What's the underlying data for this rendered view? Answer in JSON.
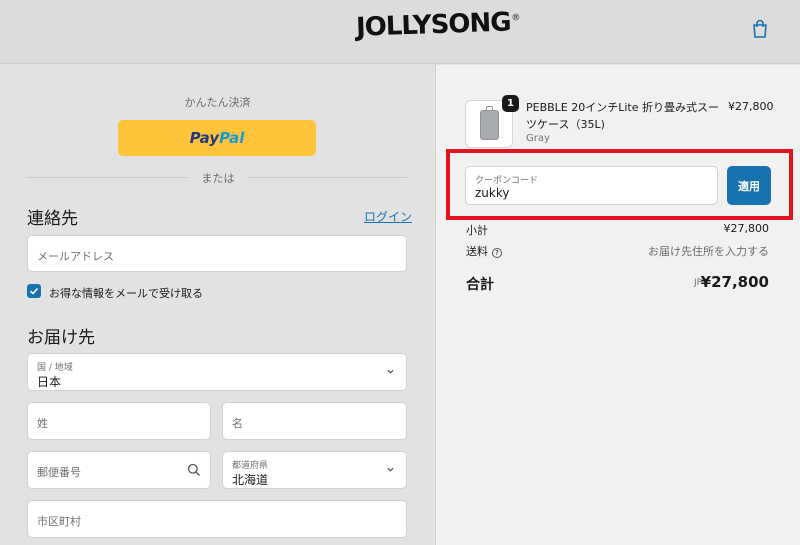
{
  "header": {
    "logo_text": "JOLLYSONG",
    "logo_mark": "®",
    "cart_icon": "shopping-bag-icon"
  },
  "express": {
    "label": "かんたん決済",
    "paypal_pay": "Pay",
    "paypal_pal": "Pal",
    "or_text": "または"
  },
  "contact": {
    "title": "連絡先",
    "login_link": "ログイン",
    "email_placeholder": "メールアドレス",
    "newsletter_label": "お得な情報をメールで受け取る",
    "newsletter_checked": true
  },
  "delivery": {
    "title": "お届け先",
    "country_label": "国 / 地域",
    "country_value": "日本",
    "last_name_placeholder": "姓",
    "first_name_placeholder": "名",
    "postal_placeholder": "郵便番号",
    "prefecture_label": "都道府県",
    "prefecture_value": "北海道",
    "city_placeholder": "市区町村"
  },
  "order": {
    "product_name": "PEBBLE 20インチLite 折り畳み式スーツケース（35L)",
    "product_variant": "Gray",
    "product_price": "¥27,800",
    "quantity": "1",
    "coupon_label": "クーポンコード",
    "coupon_value": "zukky",
    "apply_label": "適用",
    "subtotal_label": "小計",
    "subtotal_value": "¥27,800",
    "shipping_label": "送料",
    "shipping_value": "お届け先住所を入力する",
    "total_label": "合計",
    "total_currency": "JPY",
    "total_value": "¥27,800"
  },
  "colors": {
    "accent": "#1773b0",
    "paypal_yellow": "#ffc439",
    "highlight_red": "#e3141c"
  }
}
